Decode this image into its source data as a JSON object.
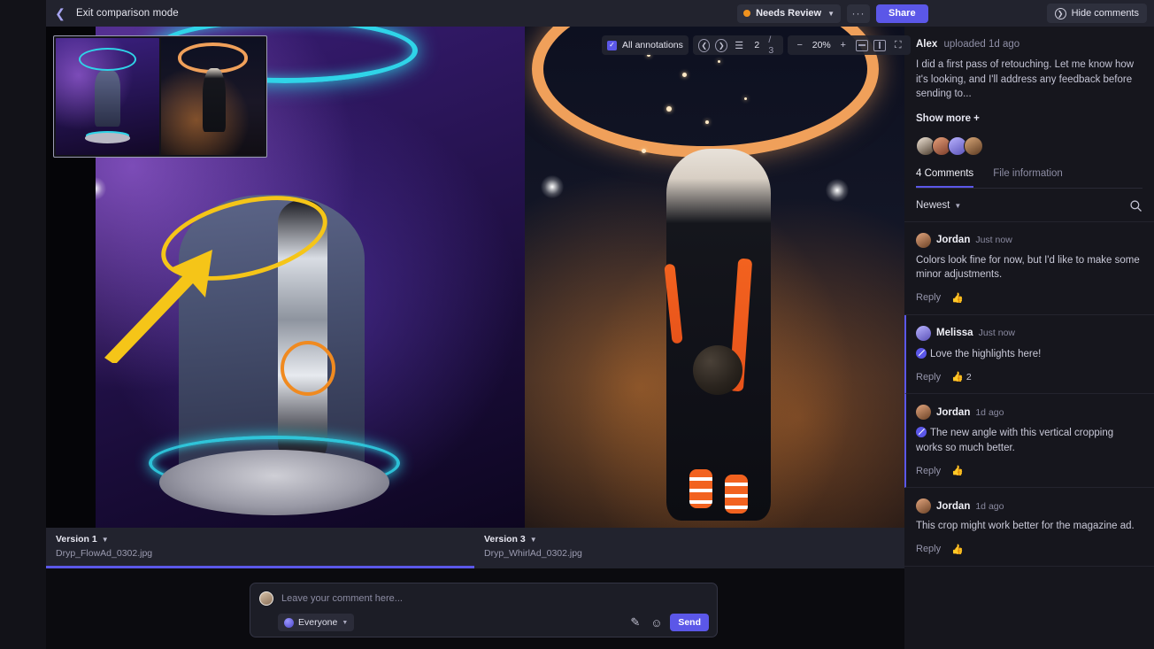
{
  "topbar": {
    "back_icon": "chevron-left-icon",
    "exit_label": "Exit comparison mode",
    "status_label": "Needs Review",
    "status_color": "#f0921e",
    "more_label": "···",
    "share_label": "Share",
    "hide_comments_label": "Hide comments",
    "accent_color": "#5b57e8"
  },
  "viewer_toolbar": {
    "annotations_label": "All annotations",
    "annotations_checked": true,
    "prev_icon": "chevron-left-circle-icon",
    "next_icon": "chevron-right-circle-icon",
    "layers_icon": "layers-icon",
    "page_current": "2",
    "page_total": "/ 3",
    "zoom_out": "−",
    "zoom_level": "20%",
    "zoom_in": "+",
    "fit_width_icon": "fit-width-icon",
    "fit_height_icon": "fit-height-icon",
    "fullscreen_icon": "fullscreen-icon"
  },
  "versions": [
    {
      "title": "Version 1",
      "file": "Dryp_FlowAd_0302.jpg",
      "active": true
    },
    {
      "title": "Version 3",
      "file": "Dryp_WhirlAd_0302.jpg",
      "active": false
    }
  ],
  "composer": {
    "placeholder": "Leave your comment here...",
    "audience": "Everyone",
    "send_label": "Send",
    "draw_icon": "draw-icon",
    "emoji_icon": "emoji-icon"
  },
  "right_panel": {
    "uploader": "Alex",
    "upload_meta": "uploaded 1d ago",
    "description": "I did a first pass of retouching. Let me know how it's looking, and I'll address any feedback before sending to...",
    "show_more": "Show more +",
    "tab_comments": "4 Comments",
    "tab_file_info": "File information",
    "sort_label": "Newest",
    "search_icon": "search-icon",
    "comments": [
      {
        "author": "Jordan",
        "time": "Just now",
        "text": "Colors look fine for now, but I'd like to make some minor adjustments.",
        "reply_label": "Reply",
        "likes": "",
        "pinned": false,
        "accent": false
      },
      {
        "author": "Melissa",
        "time": "Just now",
        "text": "Love the highlights here!",
        "reply_label": "Reply",
        "likes": "2",
        "pinned": true,
        "accent": true
      },
      {
        "author": "Jordan",
        "time": "1d ago",
        "text": "The new angle with this vertical cropping works so much better.",
        "reply_label": "Reply",
        "likes": "",
        "pinned": true,
        "accent": true
      },
      {
        "author": "Jordan",
        "time": "1d ago",
        "text": "This crop might work better for the magazine ad.",
        "reply_label": "Reply",
        "likes": "",
        "pinned": false,
        "accent": false
      }
    ]
  }
}
